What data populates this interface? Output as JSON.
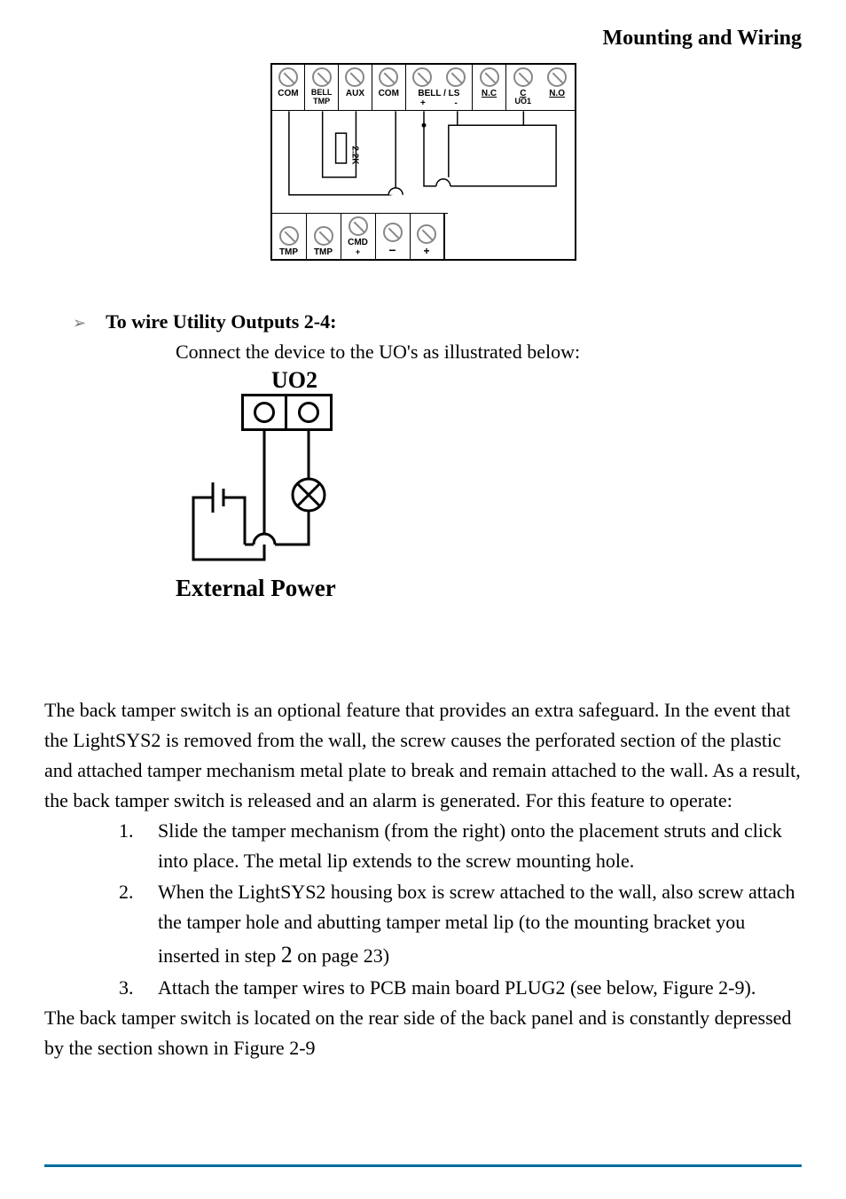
{
  "header": "Mounting and Wiring",
  "diagram_top": {
    "top_terminals": [
      {
        "label": "COM"
      },
      {
        "label": "BELL\nTMP"
      },
      {
        "label": "AUX"
      },
      {
        "label": "COM"
      },
      {
        "label": "BELL / LS",
        "sub_plus": "+"
      },
      {
        "label": "",
        "sub_minus": "-"
      },
      {
        "label": "N.C"
      },
      {
        "label": "C"
      },
      {
        "label": "N.O"
      }
    ],
    "uo1_label": "UO1",
    "resistor_label": "2.2K",
    "bottom_terminals": [
      {
        "label": "TMP"
      },
      {
        "label": "TMP"
      },
      {
        "label": "CMD",
        "sub": "+"
      },
      {
        "label": "−"
      },
      {
        "label": "+"
      }
    ]
  },
  "section": {
    "bullet": "To wire Utility Outputs 2-4:",
    "sub": "Connect the device to the UO's as illustrated below:"
  },
  "diagram_uo2": {
    "label": "UO2",
    "external": "External Power"
  },
  "body": {
    "para1": "The back tamper switch is an optional feature that provides an extra safeguard. In the event that the LightSYS2 is removed from the wall, the screw causes the perforated section of the plastic and attached tamper mechanism metal plate to break and remain attached to the wall.  As a result, the back tamper switch is released and an alarm is generated. For this feature to operate:",
    "items": [
      {
        "num": "1.",
        "text": "Slide the tamper mechanism (from the right) onto the placement struts and click into place. The metal lip extends to the screw mounting hole."
      },
      {
        "num": "2.",
        "text_pre": "When the LightSYS2 housing box is screw attached to the wall, also screw attach the tamper hole and abutting tamper metal lip (to the mounting bracket you inserted in step ",
        "step": "2",
        "text_post": " on page 23)"
      },
      {
        "num": "3.",
        "text": "Attach the tamper wires to PCB main board PLUG2 (see  below, Figure 2-9)."
      }
    ],
    "trailing": "The back tamper switch is located on the rear side of the back panel and is constantly depressed by the section shown in Figure 2-9"
  }
}
